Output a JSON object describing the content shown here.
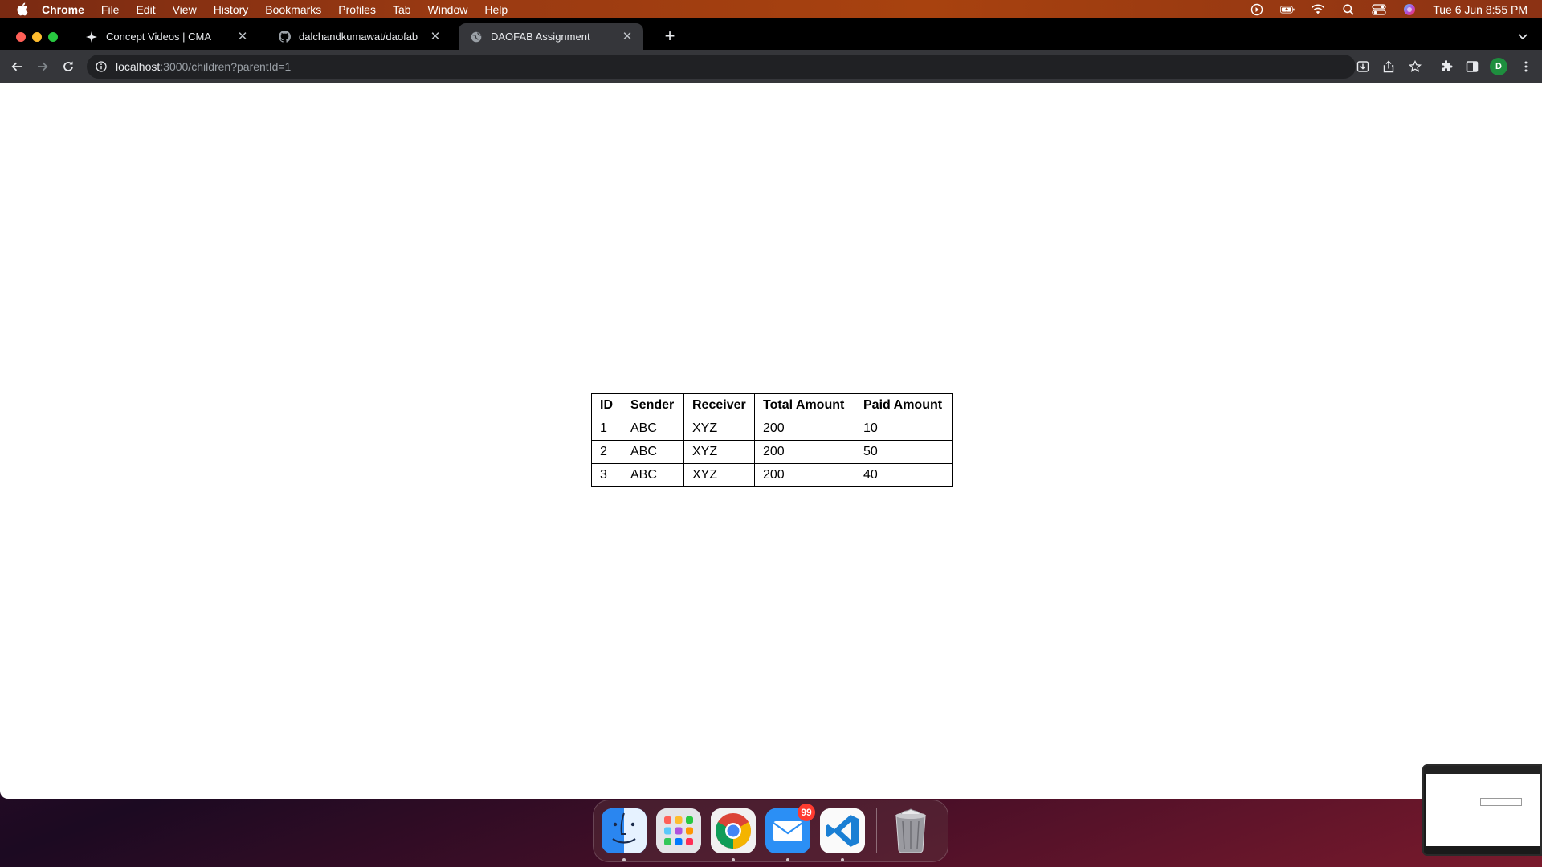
{
  "menubar": {
    "app_name": "Chrome",
    "items": [
      "File",
      "Edit",
      "View",
      "History",
      "Bookmarks",
      "Profiles",
      "Tab",
      "Window",
      "Help"
    ],
    "clock": "Tue 6 Jun  8:55 PM"
  },
  "tabs": [
    {
      "title": "Concept Videos | CMA",
      "favicon": "plus-star-icon",
      "active": false
    },
    {
      "title": "dalchandkumawat/daofab",
      "favicon": "github-icon",
      "active": false
    },
    {
      "title": "DAOFAB Assignment",
      "favicon": "globe-icon",
      "active": true
    }
  ],
  "toolbar": {
    "url_host": "localhost",
    "url_path": ":3000/children?parentId=1",
    "profile_initial": "D"
  },
  "table": {
    "headers": [
      "ID",
      "Sender",
      "Receiver",
      "Total Amount",
      "Paid Amount"
    ],
    "rows": [
      [
        "1",
        "ABC",
        "XYZ",
        "200",
        "10"
      ],
      [
        "2",
        "ABC",
        "XYZ",
        "200",
        "50"
      ],
      [
        "3",
        "ABC",
        "XYZ",
        "200",
        "40"
      ]
    ]
  },
  "dock": {
    "apps": [
      "Finder",
      "Launchpad",
      "Google Chrome",
      "Mail",
      "Visual Studio Code",
      "Trash"
    ],
    "mail_badge": "99"
  },
  "colors": {
    "tab_active": "#35363a",
    "toolbar": "#35363a",
    "omnibox": "#202124",
    "menubar": "#9a3a12",
    "accent_blue": "#1a73e8"
  }
}
